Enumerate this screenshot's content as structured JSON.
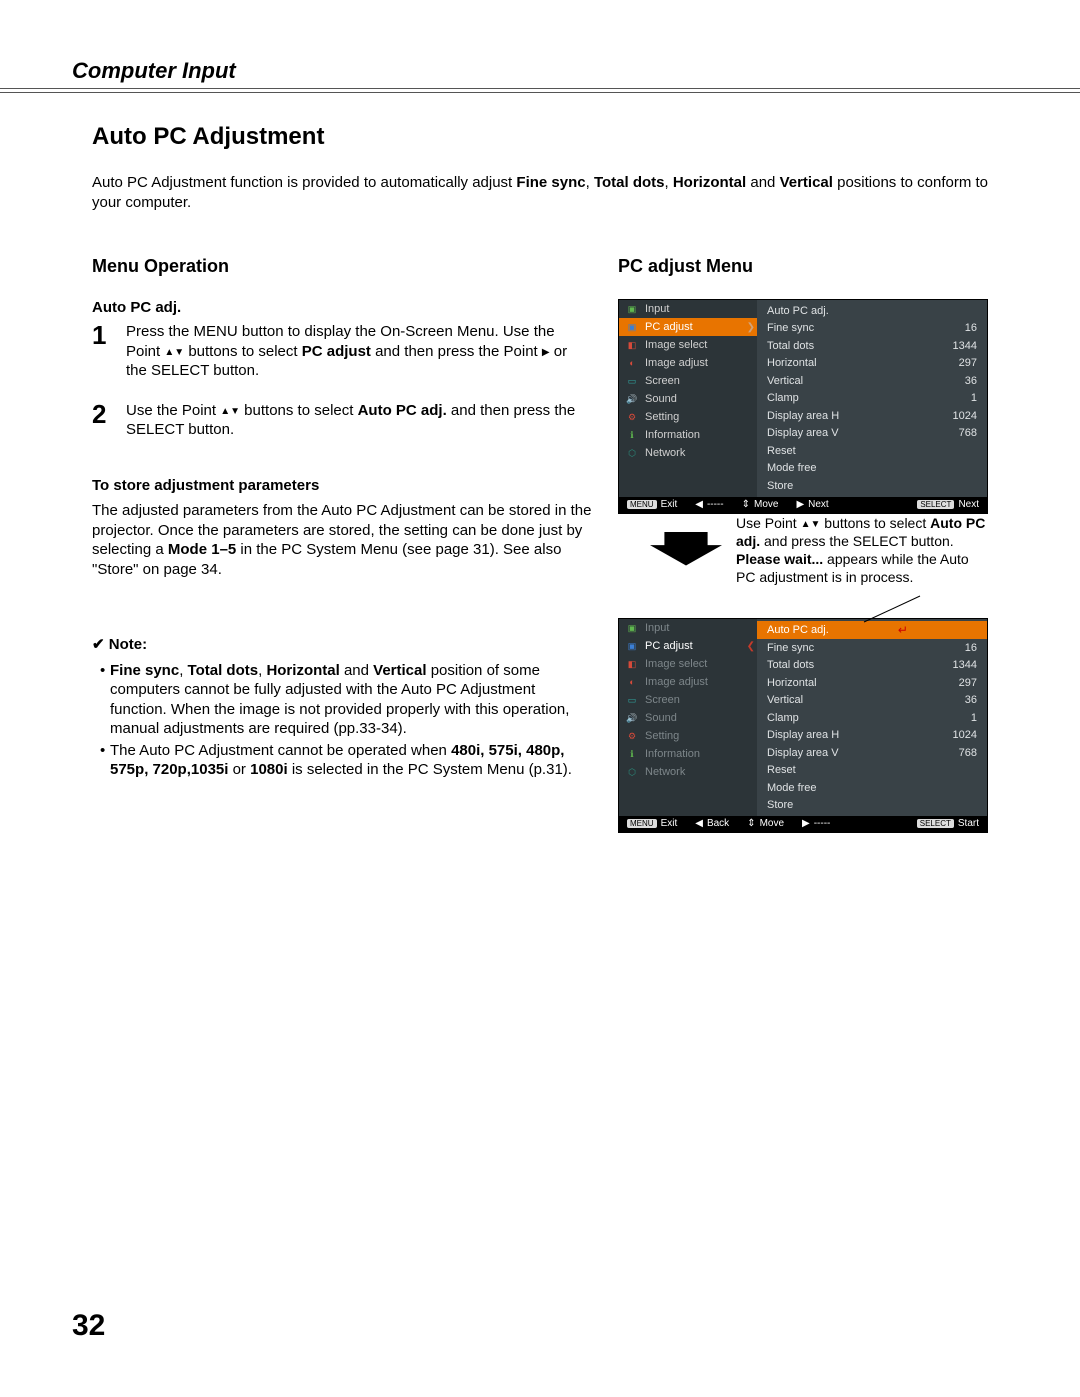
{
  "header": {
    "section": "Computer Input"
  },
  "title": "Auto PC Adjustment",
  "intro_pre": "Auto PC Adjustment function is provided to automatically adjust ",
  "intro_bold": [
    "Fine sync",
    "Total dots",
    "Horizontal",
    "Vertical"
  ],
  "intro_post": " positions to conform to your computer.",
  "menu_op": {
    "heading": "Menu Operation",
    "sub": "Auto PC adj.",
    "steps": [
      {
        "n": "1",
        "a": "Press the MENU button to display the On-Screen Menu. Use the Point ",
        "b": " buttons to select ",
        "c": "PC adjust",
        "d": " and then press the Point ",
        "e": " or the SELECT button."
      },
      {
        "n": "2",
        "a": "Use the Point ",
        "b": " buttons to select ",
        "c": "Auto PC adj.",
        "d": " and then press the SELECT button."
      }
    ],
    "store_h": "To store adjustment parameters",
    "store_t1": "The adjusted parameters from the Auto PC Adjustment can be stored in the projector. Once the parameters are stored, the setting can be done just by selecting a ",
    "store_b": "Mode 1–5",
    "store_t2": " in the PC System Menu (see page 31). See also \"Store\" on page 34.",
    "note_h": "Note:",
    "note1_b": [
      "Fine sync",
      "Total dots",
      "Horizontal",
      "Vertical"
    ],
    "note1_t": " position of some computers cannot be fully adjusted with the Auto PC Adjustment function. When the image is not provided properly with this operation, manual adjustments are required (pp.33-34).",
    "note2_a": "The Auto PC Adjustment cannot be operated when ",
    "note2_b": "480i, 575i, 480p, 575p, 720p,1035i",
    "note2_c": " or ",
    "note2_d": "1080i",
    "note2_e": " is selected in the PC System Menu (p.31)."
  },
  "right_h": "PC adjust Menu",
  "osd_items_left": [
    "Input",
    "PC adjust",
    "Image select",
    "Image adjust",
    "Screen",
    "Sound",
    "Setting",
    "Information",
    "Network"
  ],
  "osd_items_right": [
    {
      "l": "Auto PC adj.",
      "v": ""
    },
    {
      "l": "Fine sync",
      "v": "16"
    },
    {
      "l": "Total dots",
      "v": "1344"
    },
    {
      "l": "Horizontal",
      "v": "297"
    },
    {
      "l": "Vertical",
      "v": "36"
    },
    {
      "l": "Clamp",
      "v": "1"
    },
    {
      "l": "Display area H",
      "v": "1024"
    },
    {
      "l": "Display area V",
      "v": "768"
    },
    {
      "l": "Reset",
      "v": ""
    },
    {
      "l": "Mode free",
      "v": ""
    },
    {
      "l": "Store",
      "v": ""
    }
  ],
  "strip1": {
    "exit": "Exit",
    "back": "-----",
    "move": "Move",
    "next": "Next",
    "sel": "Next"
  },
  "mid": {
    "a": "Use Point ",
    "b": " buttons to select ",
    "c": "Auto PC adj.",
    "d": " and press the SELECT button. ",
    "e": "Please wait...",
    "f": " appears while the Auto PC adjustment is in process."
  },
  "strip2": {
    "exit": "Exit",
    "back": "Back",
    "move": "Move",
    "next": "-----",
    "sel": "Start"
  },
  "page": "32"
}
